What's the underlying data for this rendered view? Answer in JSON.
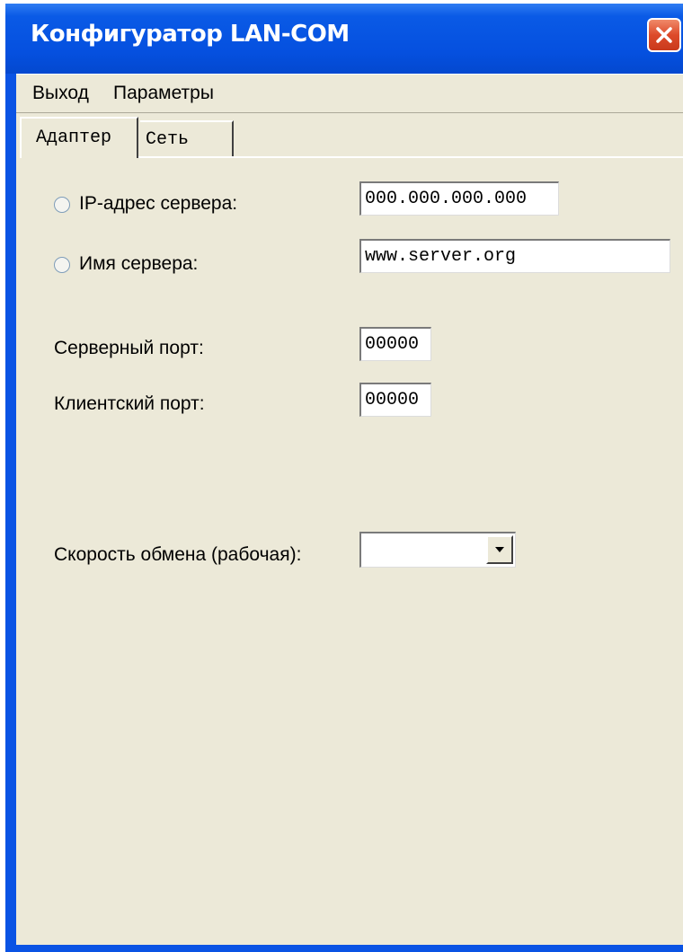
{
  "window": {
    "title": "Конфигуратор LAN-COM",
    "close_icon": "close-x-icon"
  },
  "menu": {
    "items": [
      "Выход",
      "Параметры"
    ]
  },
  "tabs": [
    {
      "label": "Адаптер",
      "active": true
    },
    {
      "label": "Сеть",
      "active": false
    }
  ],
  "adapter": {
    "ip_label": "IP-адрес сервера:",
    "ip_value": "000.000.000.000",
    "name_label": "Имя сервера:",
    "name_value": "www.server.org",
    "server_port_label": "Серверный порт:",
    "server_port_value": "00000",
    "client_port_label": "Клиентский порт:",
    "client_port_value": "00000",
    "speed_label": "Скорость обмена (рабочая):",
    "speed_value": ""
  },
  "colors": {
    "titlebar": "#0550df",
    "face": "#ece9d8",
    "close": "#dd4a2a"
  }
}
